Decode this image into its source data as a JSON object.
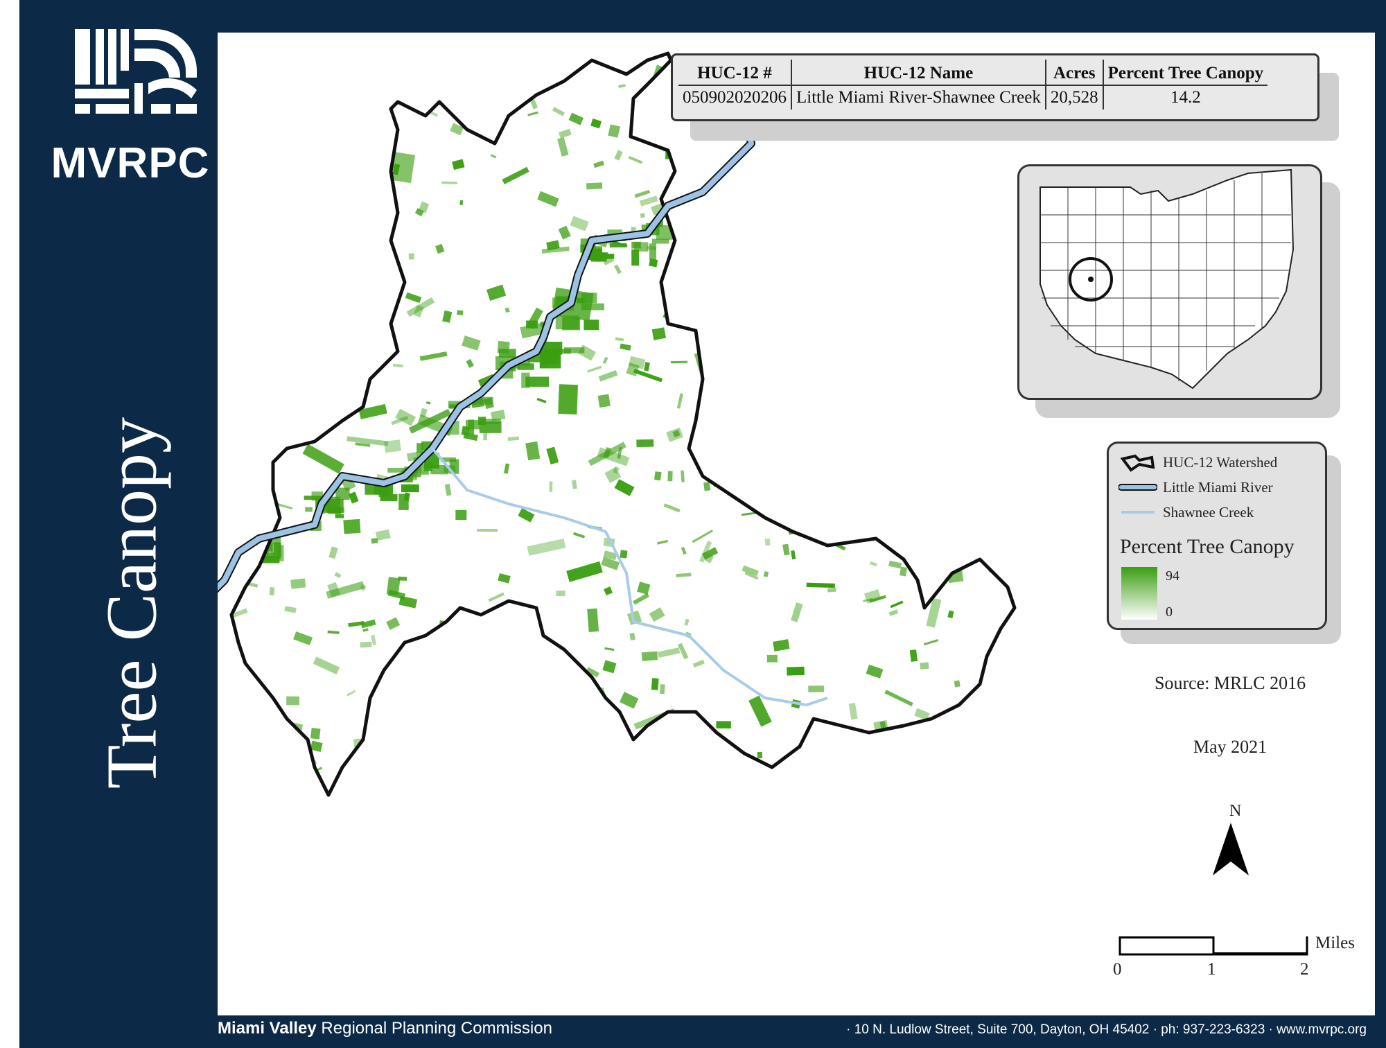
{
  "title": "Tree Canopy",
  "logo": {
    "text": "MVRPC"
  },
  "huc_table": {
    "headers": [
      "HUC-12 #",
      "HUC-12 Name",
      "Acres",
      "Percent Tree Canopy"
    ],
    "row": [
      "050902020206",
      "Little Miami River-Shawnee Creek",
      "20,528",
      "14.2"
    ]
  },
  "legend": {
    "items": [
      {
        "label": "HUC-12 Watershed",
        "icon": "watershed-outline-icon"
      },
      {
        "label": "Little Miami River",
        "icon": "river-line-icon"
      },
      {
        "label": "Shawnee Creek",
        "icon": "creek-line-icon"
      }
    ],
    "heading": "Percent Tree Canopy",
    "ramp_max": "94",
    "ramp_min": "0"
  },
  "source": "Source: MRLC 2016",
  "date": "May 2021",
  "north_label": "N",
  "scale": {
    "ticks": [
      "0",
      "1",
      "2"
    ],
    "unit": "Miles"
  },
  "footer": {
    "org_bold": "Miami Valley",
    "org_rest": " Regional Planning Commission",
    "contact": "· 10 N. Ludlow Street, Suite 700, Dayton, OH  45402 · ph: 937-223-6323 · www.mvrpc.org"
  },
  "colors": {
    "navy": "#0c2a47",
    "canopy_green": "#3a9e10",
    "river_blue": "#9cc3e4",
    "outline": "#111111"
  }
}
